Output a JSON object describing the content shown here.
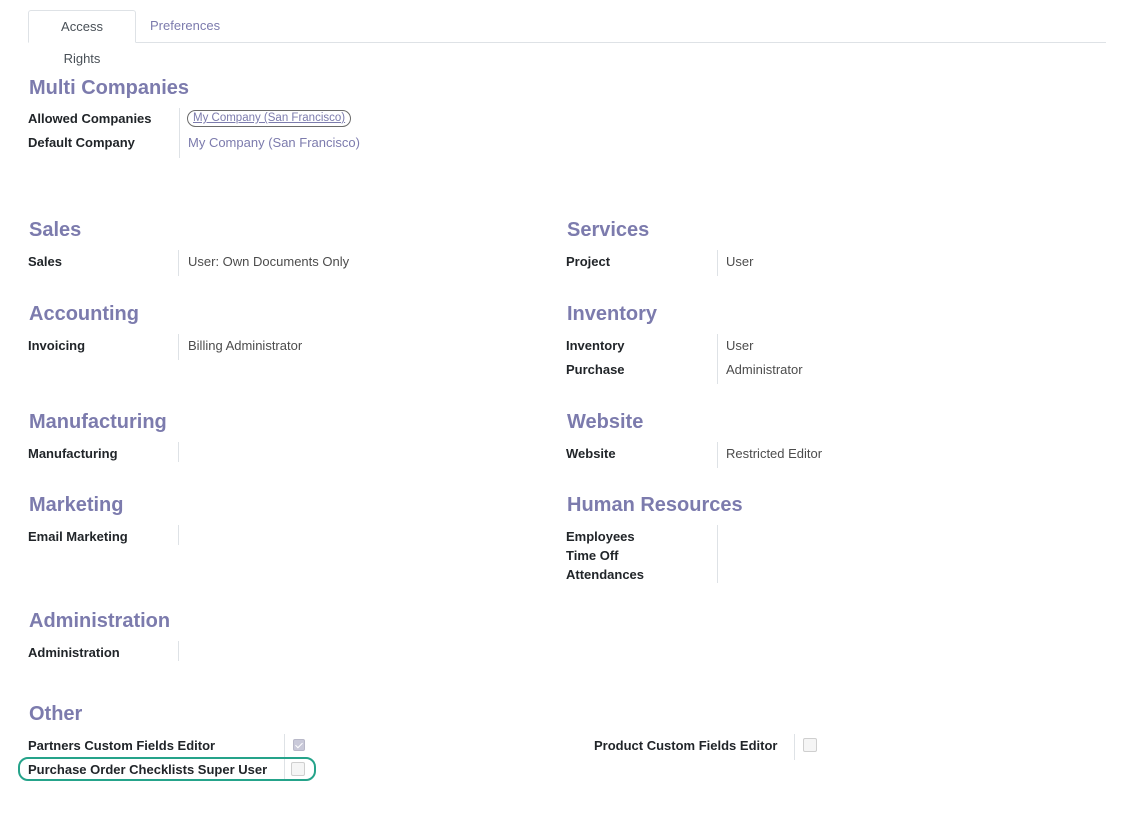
{
  "tabs": {
    "access_rights": "Access Rights",
    "preferences": "Preferences"
  },
  "multi_companies": {
    "title": "Multi Companies",
    "allowed_label": "Allowed Companies",
    "allowed_value": "My Company (San Francisco)",
    "default_label": "Default Company",
    "default_value": "My Company (San Francisco)"
  },
  "sales": {
    "title": "Sales",
    "label": "Sales",
    "value": "User: Own Documents Only"
  },
  "services": {
    "title": "Services",
    "label": "Project",
    "value": "User"
  },
  "accounting": {
    "title": "Accounting",
    "label": "Invoicing",
    "value": "Billing Administrator"
  },
  "inventory": {
    "title": "Inventory",
    "inventory_label": "Inventory",
    "inventory_value": "User",
    "purchase_label": "Purchase",
    "purchase_value": "Administrator"
  },
  "manufacturing": {
    "title": "Manufacturing",
    "label": "Manufacturing",
    "value": ""
  },
  "website": {
    "title": "Website",
    "label": "Website",
    "value": "Restricted Editor"
  },
  "marketing": {
    "title": "Marketing",
    "label": "Email Marketing",
    "value": ""
  },
  "human_resources": {
    "title": "Human Resources",
    "employees": "Employees",
    "time_off": "Time Off",
    "attendances": "Attendances"
  },
  "administration": {
    "title": "Administration",
    "label": "Administration",
    "value": ""
  },
  "other": {
    "title": "Other",
    "partners_label": "Partners Custom Fields Editor",
    "partners_checked": true,
    "product_label": "Product Custom Fields Editor",
    "product_checked": false,
    "po_label": "Purchase Order Checklists Super User",
    "po_checked": false
  },
  "colors": {
    "accent": "#7c7bad",
    "highlight": "#25a38a"
  }
}
